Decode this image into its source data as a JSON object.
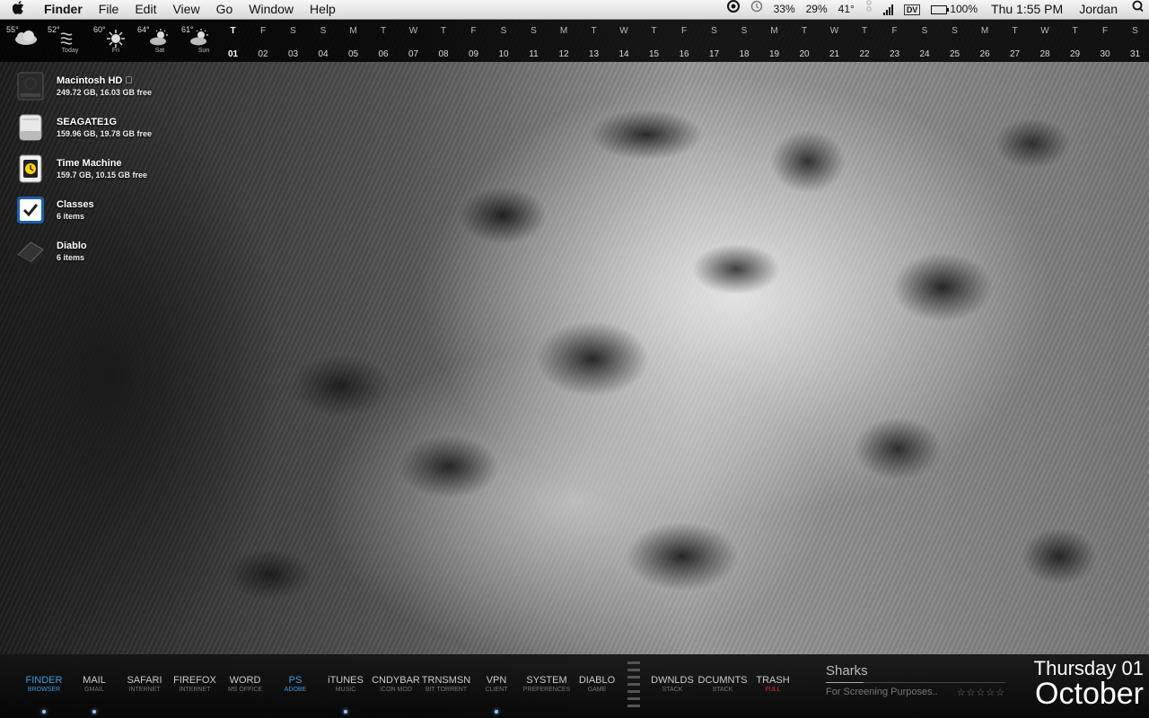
{
  "menubar": {
    "app": "Finder",
    "menus": [
      "File",
      "Edit",
      "View",
      "Go",
      "Window",
      "Help"
    ],
    "status": {
      "cpu": "33%",
      "mem": "29%",
      "temp": "41°",
      "dv": "DV",
      "battery": "100%",
      "clock": "Thu 1:55 PM",
      "user": "Jordan"
    }
  },
  "weather": [
    {
      "temp": "55°",
      "day": "",
      "icon": "partly-cloudy-icon"
    },
    {
      "temp": "52°",
      "day": "Today",
      "icon": "wind-icon"
    },
    {
      "temp": "60°",
      "day": "Fri",
      "icon": "sun-icon"
    },
    {
      "temp": "64°",
      "day": "Sat",
      "icon": "partly-sunny-icon"
    },
    {
      "temp": "61°",
      "day": "Sun",
      "icon": "partly-sunny-icon"
    }
  ],
  "calendar": {
    "today_index": 0,
    "days": [
      {
        "dow": "T",
        "num": "01"
      },
      {
        "dow": "F",
        "num": "02"
      },
      {
        "dow": "S",
        "num": "03"
      },
      {
        "dow": "S",
        "num": "04"
      },
      {
        "dow": "M",
        "num": "05"
      },
      {
        "dow": "T",
        "num": "06"
      },
      {
        "dow": "W",
        "num": "07"
      },
      {
        "dow": "T",
        "num": "08"
      },
      {
        "dow": "F",
        "num": "09"
      },
      {
        "dow": "S",
        "num": "10"
      },
      {
        "dow": "S",
        "num": "11"
      },
      {
        "dow": "M",
        "num": "12"
      },
      {
        "dow": "T",
        "num": "13"
      },
      {
        "dow": "W",
        "num": "14"
      },
      {
        "dow": "T",
        "num": "15"
      },
      {
        "dow": "F",
        "num": "16"
      },
      {
        "dow": "S",
        "num": "17"
      },
      {
        "dow": "S",
        "num": "18"
      },
      {
        "dow": "M",
        "num": "19"
      },
      {
        "dow": "T",
        "num": "20"
      },
      {
        "dow": "W",
        "num": "21"
      },
      {
        "dow": "T",
        "num": "22"
      },
      {
        "dow": "F",
        "num": "23"
      },
      {
        "dow": "S",
        "num": "24"
      },
      {
        "dow": "S",
        "num": "25"
      },
      {
        "dow": "M",
        "num": "26"
      },
      {
        "dow": "T",
        "num": "27"
      },
      {
        "dow": "W",
        "num": "28"
      },
      {
        "dow": "T",
        "num": "29"
      },
      {
        "dow": "F",
        "num": "30"
      },
      {
        "dow": "S",
        "num": "31"
      }
    ]
  },
  "desktop": [
    {
      "name": "Macintosh HD ",
      "sub": "249.72 GB, 16.03 GB free",
      "icon": "hard-drive-icon"
    },
    {
      "name": "SEAGATE1G",
      "sub": "159.96 GB, 19.78 GB free",
      "icon": "external-drive-icon"
    },
    {
      "name": "Time Machine",
      "sub": "159.7 GB, 10.15 GB free",
      "icon": "time-machine-drive-icon"
    },
    {
      "name": "Classes",
      "sub": "6 items",
      "icon": "checkbox-folder-icon"
    },
    {
      "name": "Diablo",
      "sub": "6 items",
      "icon": "game-folder-icon"
    }
  ],
  "dock": [
    {
      "label": "FINDER",
      "sub": "BROWSER",
      "active": true,
      "running": true
    },
    {
      "label": "MAIL",
      "sub": "GMAIL",
      "running": true
    },
    {
      "label": "SAFARI",
      "sub": "INTERNET"
    },
    {
      "label": "FIREFOX",
      "sub": "INTERNET"
    },
    {
      "label": "WORD",
      "sub": "MS OFFICE"
    },
    {
      "label": "PS",
      "sub": "ADOBE",
      "active": true
    },
    {
      "label": "iTUNES",
      "sub": "MUSIC",
      "running": true
    },
    {
      "label": "CNDYBAR",
      "sub": "ICON MOD"
    },
    {
      "label": "TRNSMSN",
      "sub": "BIT TORRENT"
    },
    {
      "label": "VPN",
      "sub": "CLIENT",
      "running": true
    },
    {
      "label": "SYSTEM",
      "sub": "PREFERENCES"
    },
    {
      "label": "DIABLO",
      "sub": "GAME"
    },
    {
      "label": "DWNLDS",
      "sub": "STACK"
    },
    {
      "label": "DCUMNTS",
      "sub": "STACK"
    },
    {
      "label": "TRASH",
      "sub": "FULL",
      "trash": true
    }
  ],
  "music": {
    "track": "Sharks",
    "artist": "For Screening Purposes..",
    "rating": "☆☆☆☆☆"
  },
  "date_widget": {
    "weekday": "Thursday",
    "day": "01",
    "month": "October"
  },
  "colors": {
    "accent": "#3b9de0",
    "trash_full": "#e03030"
  }
}
